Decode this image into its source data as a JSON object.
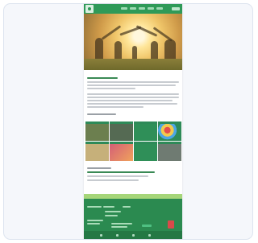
{
  "colors": {
    "brand_green": "#2f9a58",
    "nav_light": "#9fdab4",
    "footer_green": "#2b8a50",
    "lime_band": "#a6d679",
    "text_gray": "#c7cbd0"
  },
  "icons": {
    "logo": "logo-icon",
    "search": "search-icon"
  },
  "tiles": [
    {
      "name": "tile-children-activity",
      "bg": "#6c7f4f"
    },
    {
      "name": "tile-group-photo",
      "bg": "#556a53"
    },
    {
      "name": "tile-green-1",
      "bg": "#2f8f58"
    },
    {
      "name": "tile-balloons",
      "bg": "#e8b84c"
    },
    {
      "name": "tile-classroom",
      "bg": "#c6b07a"
    },
    {
      "name": "tile-kids-playing",
      "bg": "#d25a78"
    },
    {
      "name": "tile-green-2",
      "bg": "#2f8f58"
    },
    {
      "name": "tile-outdoor",
      "bg": "#6f7b72"
    }
  ]
}
